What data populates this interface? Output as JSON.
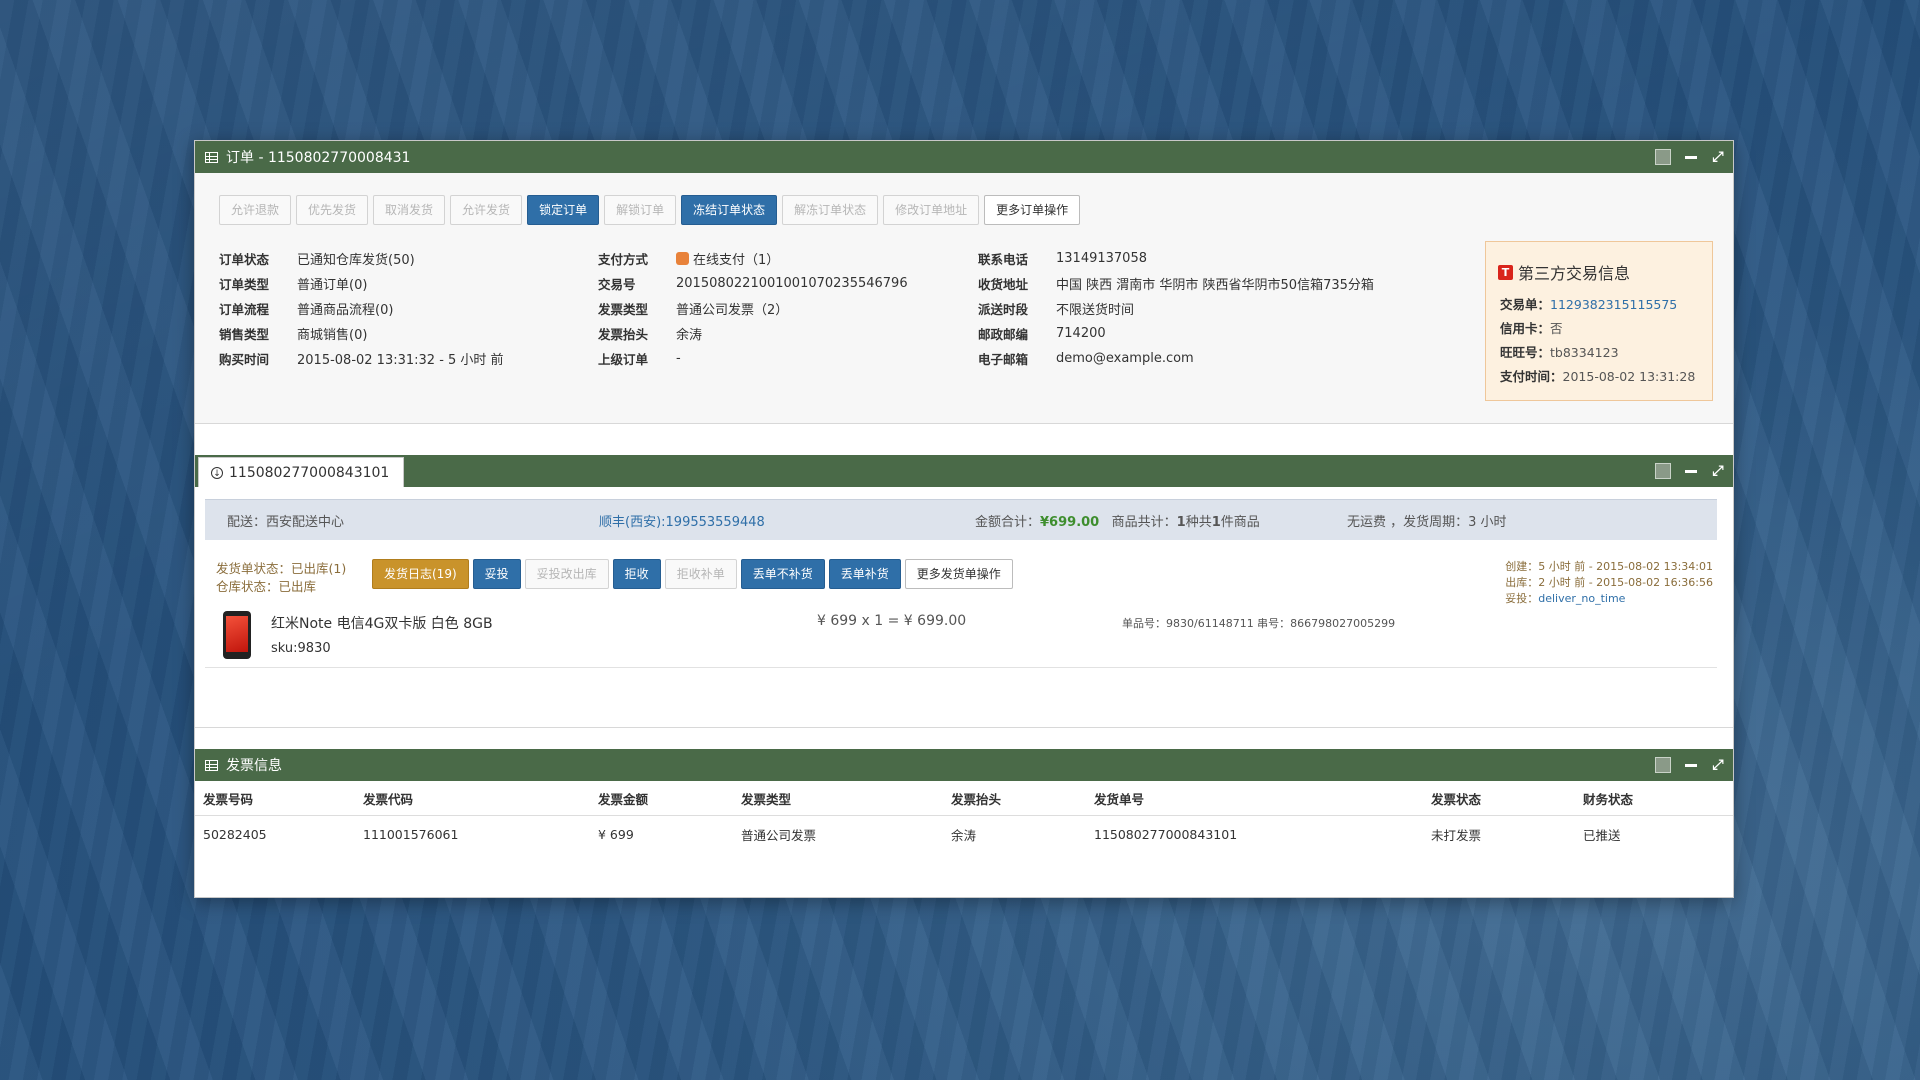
{
  "order": {
    "title": "订单 - 1150802770008431",
    "buttons": [
      {
        "label": "允许退款",
        "style": "disabled"
      },
      {
        "label": "优先发货",
        "style": "disabled"
      },
      {
        "label": "取消发货",
        "style": "disabled"
      },
      {
        "label": "允许发货",
        "style": "disabled"
      },
      {
        "label": "锁定订单",
        "style": "primary"
      },
      {
        "label": "解锁订单",
        "style": "disabled"
      },
      {
        "label": "冻结订单状态",
        "style": "primary"
      },
      {
        "label": "解冻订单状态",
        "style": "disabled"
      },
      {
        "label": "修改订单地址",
        "style": "disabled"
      },
      {
        "label": "更多订单操作",
        "style": "default"
      }
    ],
    "col1": [
      {
        "label": "订单状态",
        "value": "已通知仓库发货(50)"
      },
      {
        "label": "订单类型",
        "value": "普通订单(0)"
      },
      {
        "label": "订单流程",
        "value": "普通商品流程(0)"
      },
      {
        "label": "销售类型",
        "value": "商城销售(0)"
      },
      {
        "label": "购买时间",
        "value": "2015-08-02 13:31:32 - 5 小时 前"
      }
    ],
    "col2": [
      {
        "label": "支付方式",
        "value": "在线支付（1）"
      },
      {
        "label": "交易号",
        "value": "2015080221001001070235546796"
      },
      {
        "label": "发票类型",
        "value": "普通公司发票（2）"
      },
      {
        "label": "发票抬头",
        "value": "余涛"
      },
      {
        "label": "上级订单",
        "value": "-"
      }
    ],
    "col3": [
      {
        "label": "联系电话",
        "value": "13149137058"
      },
      {
        "label": "收货地址",
        "value": "中国 陕西 渭南市 华阴市 陕西省华阴市50信箱735分箱"
      },
      {
        "label": "派送时段",
        "value": "不限送货时间"
      },
      {
        "label": "邮政邮编",
        "value": "714200"
      },
      {
        "label": "电子邮箱",
        "value": "demo@example.com"
      }
    ],
    "third_party": {
      "title": "第三方交易信息",
      "icon": "T",
      "trade_label": "交易单：",
      "trade_value": "1129382315115575",
      "credit_label": "信用卡：",
      "credit_value": "否",
      "wangwang_label": "旺旺号：",
      "wangwang_value": "tb8334123",
      "pay_time_label": "支付时间：",
      "pay_time_value": "2015-08-02 13:31:28"
    }
  },
  "shipment": {
    "tab_label": "115080277000843101",
    "bar": {
      "delivery": "配送：西安配送中心",
      "courier": "顺丰(西安):199553559448",
      "amount_label": "金额合计：",
      "amount": "¥699.00",
      "goods_label": "商品共计：",
      "goods_n1": "1",
      "goods_mid": "种共",
      "goods_n2": "1",
      "goods_tail": "件商品",
      "shipping": "无运费 ，发货周期：3 小时"
    },
    "status_line1": "发货单状态：已出库(1)",
    "status_line2": "仓库状态：已出库",
    "buttons": [
      {
        "label": "发货日志(19)",
        "style": "warning"
      },
      {
        "label": "妥投",
        "style": "primary"
      },
      {
        "label": "妥投改出库",
        "style": "disabled"
      },
      {
        "label": "拒收",
        "style": "primary"
      },
      {
        "label": "拒收补单",
        "style": "disabled"
      },
      {
        "label": "丢单不补货",
        "style": "primary"
      },
      {
        "label": "丢单补货",
        "style": "primary"
      },
      {
        "label": "更多发货单操作",
        "style": "default"
      }
    ],
    "meta_created": "创建：5 小时 前 - 2015-08-02 13:34:01",
    "meta_out": "出库：2 小时 前 - 2015-08-02 16:36:56",
    "meta_delivered_label": "妥投：",
    "meta_delivered_value": "deliver_no_time",
    "product": {
      "name": "红米Note 电信4G双卡版 白色 8GB",
      "sku": "sku:9830",
      "price": "¥ 699 x 1 = ¥ 699.00",
      "serial": "单品号：9830/61148711   串号：866798027005299"
    }
  },
  "invoice": {
    "title": "发票信息",
    "headers": [
      "发票号码",
      "发票代码",
      "发票金额",
      "发票类型",
      "发票抬头",
      "发货单号",
      "发票状态",
      "财务状态"
    ],
    "rows": [
      [
        "50282405",
        "111001576061",
        "¥ 699",
        "普通公司发票",
        "余涛",
        "115080277000843101",
        "未打发票",
        "已推送"
      ]
    ]
  },
  "colors": {
    "header": "#4a6a48",
    "primary": "#2f6fa8",
    "warning": "#c9932b",
    "third_bg": "#fdf1e0"
  }
}
